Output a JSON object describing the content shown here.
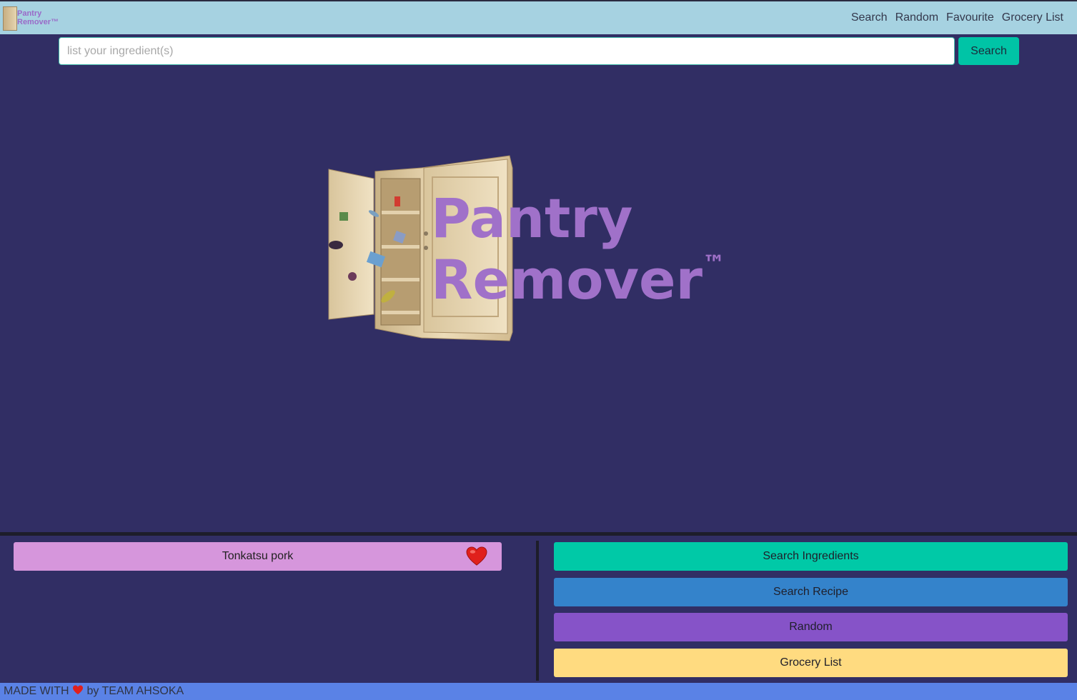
{
  "brand": {
    "line1": "Pantry",
    "line2": "Remover™"
  },
  "nav": {
    "search": "Search",
    "random": "Random",
    "favourite": "Favourite",
    "grocery_list": "Grocery List"
  },
  "search": {
    "placeholder": "list your ingredient(s)",
    "value": "",
    "button": "Search"
  },
  "hero": {
    "line1": "Pantry",
    "line2": "Remover",
    "tm": "™"
  },
  "favourites": {
    "items": [
      {
        "label": "Tonkatsu pork",
        "icon": "heart-icon"
      }
    ]
  },
  "actions": {
    "search_ingredients": {
      "label": "Search Ingredients",
      "color": "#00c9a7"
    },
    "search_recipe": {
      "label": "Search Recipe",
      "color": "#3483cb"
    },
    "random": {
      "label": "Random",
      "color": "#8653c8"
    },
    "grocery_list": {
      "label": "Grocery List",
      "color": "#ffdb80"
    }
  },
  "footer": {
    "made_with": "MADE WITH",
    "by_team": "by TEAM AHSOKA"
  },
  "colors": {
    "background": "#312e64",
    "topbar": "#a6d2e1",
    "accent": "#00c4a6",
    "favourite_item": "#d696dc",
    "footer": "#5a82e6"
  }
}
